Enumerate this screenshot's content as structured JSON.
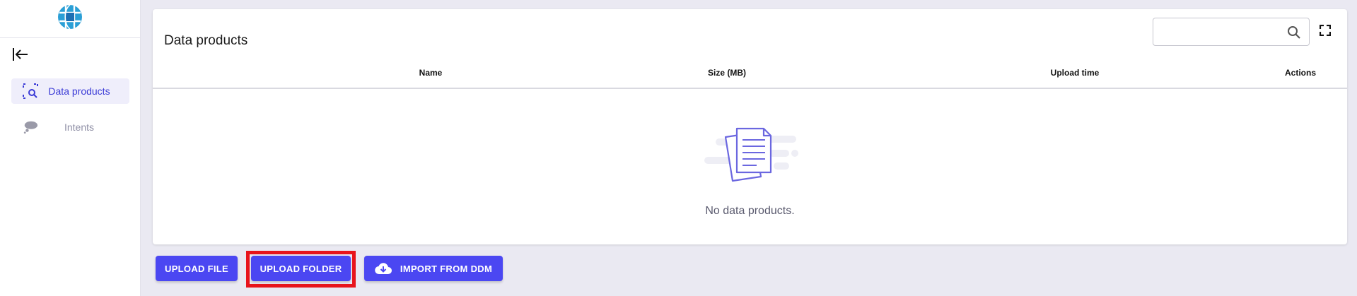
{
  "sidebar": {
    "logo": "globe-logo",
    "collapse_icon": "collapse-left-icon",
    "items": [
      {
        "label": "Data products",
        "icon": "data-search-icon",
        "active": true
      },
      {
        "label": "Intents",
        "icon": "cloud-thought-icon",
        "active": false
      }
    ]
  },
  "main": {
    "title": "Data products",
    "search": {
      "value": "",
      "placeholder": ""
    },
    "columns": [
      "Name",
      "Size (MB)",
      "Upload time",
      "Actions"
    ],
    "rows": [],
    "empty_message": "No data products."
  },
  "actions": {
    "upload_file": "UPLOAD FILE",
    "upload_folder": "UPLOAD FOLDER",
    "import_from_ddm": "IMPORT FROM DDM"
  },
  "colors": {
    "accent": "#4b47f2",
    "background": "#eae9f2",
    "highlight": "#e8141c"
  }
}
